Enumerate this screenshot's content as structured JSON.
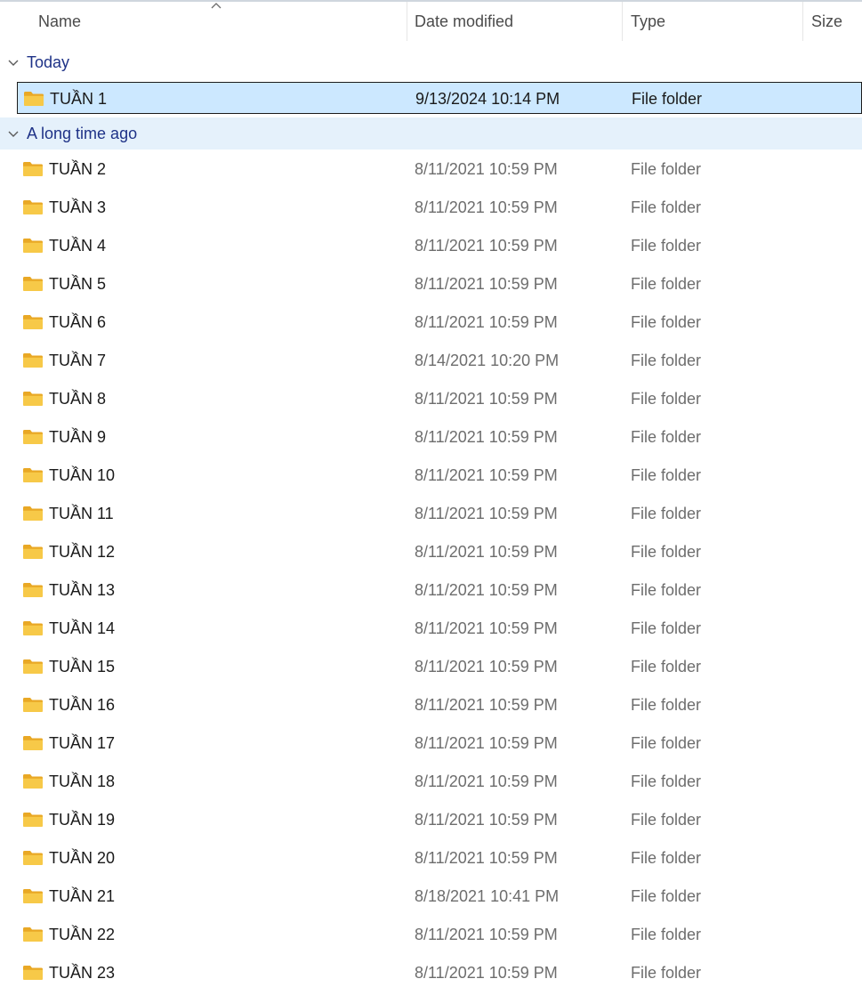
{
  "columns": {
    "name": "Name",
    "date": "Date modified",
    "type": "Type",
    "size": "Size"
  },
  "groups": [
    {
      "label": "Today",
      "items": [
        {
          "name": "TUẦN 1",
          "date": "9/13/2024 10:14 PM",
          "type": "File folder",
          "selected": true
        }
      ]
    },
    {
      "label": "A long time ago",
      "items": [
        {
          "name": "TUẦN 2",
          "date": "8/11/2021 10:59 PM",
          "type": "File folder"
        },
        {
          "name": "TUẦN 3",
          "date": "8/11/2021 10:59 PM",
          "type": "File folder"
        },
        {
          "name": "TUẦN 4",
          "date": "8/11/2021 10:59 PM",
          "type": "File folder"
        },
        {
          "name": "TUẦN 5",
          "date": "8/11/2021 10:59 PM",
          "type": "File folder"
        },
        {
          "name": "TUẦN 6",
          "date": "8/11/2021 10:59 PM",
          "type": "File folder"
        },
        {
          "name": "TUẦN 7",
          "date": "8/14/2021 10:20 PM",
          "type": "File folder"
        },
        {
          "name": "TUẦN 8",
          "date": "8/11/2021 10:59 PM",
          "type": "File folder"
        },
        {
          "name": "TUẦN 9",
          "date": "8/11/2021 10:59 PM",
          "type": "File folder"
        },
        {
          "name": "TUẦN 10",
          "date": "8/11/2021 10:59 PM",
          "type": "File folder"
        },
        {
          "name": "TUẦN 11",
          "date": "8/11/2021 10:59 PM",
          "type": "File folder"
        },
        {
          "name": "TUẦN 12",
          "date": "8/11/2021 10:59 PM",
          "type": "File folder"
        },
        {
          "name": "TUẦN 13",
          "date": "8/11/2021 10:59 PM",
          "type": "File folder"
        },
        {
          "name": "TUẦN 14",
          "date": "8/11/2021 10:59 PM",
          "type": "File folder"
        },
        {
          "name": "TUẦN 15",
          "date": "8/11/2021 10:59 PM",
          "type": "File folder"
        },
        {
          "name": "TUẦN 16",
          "date": "8/11/2021 10:59 PM",
          "type": "File folder"
        },
        {
          "name": "TUẦN 17",
          "date": "8/11/2021 10:59 PM",
          "type": "File folder"
        },
        {
          "name": "TUẦN 18",
          "date": "8/11/2021 10:59 PM",
          "type": "File folder"
        },
        {
          "name": "TUẦN 19",
          "date": "8/11/2021 10:59 PM",
          "type": "File folder"
        },
        {
          "name": "TUẦN 20",
          "date": "8/11/2021 10:59 PM",
          "type": "File folder"
        },
        {
          "name": "TUẦN 21",
          "date": "8/18/2021 10:41 PM",
          "type": "File folder"
        },
        {
          "name": "TUẦN 22",
          "date": "8/11/2021 10:59 PM",
          "type": "File folder"
        },
        {
          "name": "TUẦN 23",
          "date": "8/11/2021 10:59 PM",
          "type": "File folder"
        }
      ]
    }
  ],
  "icons": {
    "folder": "folder-icon",
    "group_toggle": "chevron-down-icon",
    "sort": "sort-ascending-icon"
  },
  "colors": {
    "group_label": "#1e3287",
    "selection": "#cce8ff",
    "folder": "#f5c342"
  }
}
